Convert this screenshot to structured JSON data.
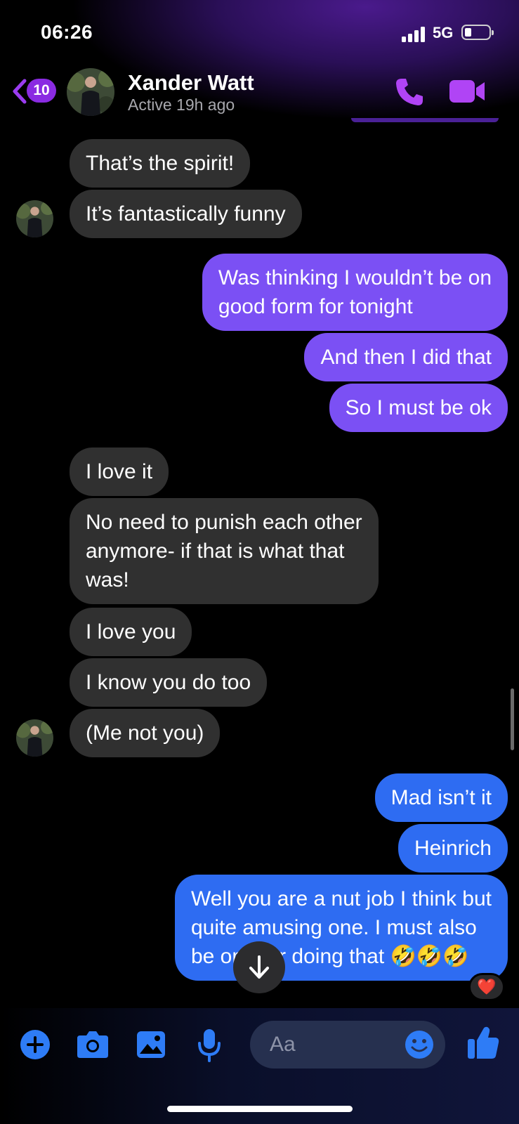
{
  "status_bar": {
    "time": "06:26",
    "network": "5G"
  },
  "header": {
    "unread_count": "10",
    "contact_name": "Xander Watt",
    "contact_status": "Active 19h ago"
  },
  "messages": [
    {
      "id": "m1",
      "text": "That’s the spirit!",
      "sender": "them"
    },
    {
      "id": "m2",
      "text": "It’s fantastically funny",
      "sender": "them"
    },
    {
      "id": "m3",
      "lines": [
        "Was thinking I wouldn’t be on",
        "good form for tonight"
      ],
      "sender": "me"
    },
    {
      "id": "m4",
      "text": "And then I did that",
      "sender": "me"
    },
    {
      "id": "m5",
      "text": "So I must be ok",
      "sender": "me"
    },
    {
      "id": "m6",
      "text": "I love it",
      "sender": "them"
    },
    {
      "id": "m7",
      "lines": [
        "No need to punish each other",
        "anymore- if that is what that",
        "was!"
      ],
      "sender": "them"
    },
    {
      "id": "m8",
      "text": "I love you",
      "sender": "them"
    },
    {
      "id": "m9",
      "text": "I know you do too",
      "sender": "them"
    },
    {
      "id": "m10",
      "text": "(Me not you)",
      "sender": "them"
    },
    {
      "id": "m11",
      "text": "Mad isn’t it",
      "sender": "me"
    },
    {
      "id": "m12",
      "text": "Heinrich",
      "sender": "me"
    },
    {
      "id": "m13",
      "lines": [
        "Well you are a nut job I think but",
        "quite amusing one. I must also",
        "be one for doing that 🤣🤣🤣"
      ],
      "sender": "me",
      "reaction": "❤️"
    }
  ],
  "composer": {
    "placeholder": "Aa",
    "icons": [
      "plus-icon",
      "camera-icon",
      "image-icon",
      "microphone-icon",
      "emoji-icon",
      "thumbs-up-icon"
    ]
  },
  "colors": {
    "incoming_bubble": "#303030",
    "outgoing_purple": "#7b50f4",
    "outgoing_blue": "#2e6cf2",
    "accent": "#8a2be2",
    "composer_icon": "#2e7cf6"
  }
}
